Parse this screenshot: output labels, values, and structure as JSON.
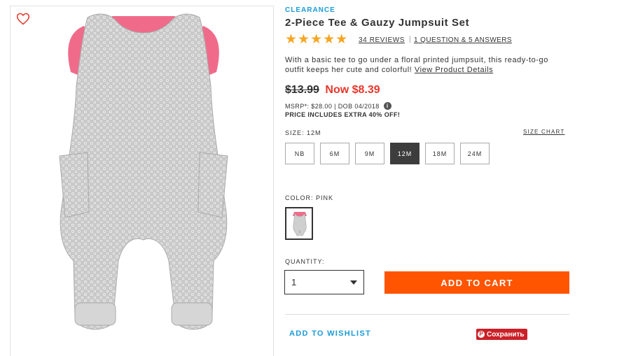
{
  "product": {
    "badge": "CLEARANCE",
    "title": "2-Piece Tee & Gauzy Jumpsuit Set",
    "rating_stars": "★★★★★",
    "rating_value": 5,
    "reviews_link": "34 REVIEWS",
    "qa_link": "1 QUESTION & 5 ANSWERS",
    "description": "With a basic tee to go under a floral printed jumpsuit, this ready-to-go outfit keeps her cute and colorful! ",
    "details_link": "View Product Details"
  },
  "pricing": {
    "old_price": "$13.99",
    "now_price": "Now $8.39",
    "msrp": "MSRP*: $28.00 | DOB 04/2018",
    "info_icon": "i",
    "promo": "PRICE INCLUDES EXTRA 40% OFF!"
  },
  "size": {
    "label": "SIZE: 12M",
    "chart_link": "SIZE CHART",
    "options": [
      "NB",
      "6M",
      "9M",
      "12M",
      "18M",
      "24M"
    ],
    "selected": "12M"
  },
  "color": {
    "label": "COLOR: PINK"
  },
  "quantity": {
    "label": "QUANTITY:",
    "value": "1"
  },
  "actions": {
    "add_to_cart": "ADD TO CART",
    "wishlist": "ADD TO WISHLIST",
    "pin_label": "Сохранить",
    "pin_icon": "P"
  },
  "colors": {
    "accent_blue": "#1a9bd7",
    "sale_red": "#e8362b",
    "cta_orange": "#ff5500",
    "star": "#f5a623",
    "tee_pink": "#f06b8a",
    "pinterest": "#cb2027"
  }
}
